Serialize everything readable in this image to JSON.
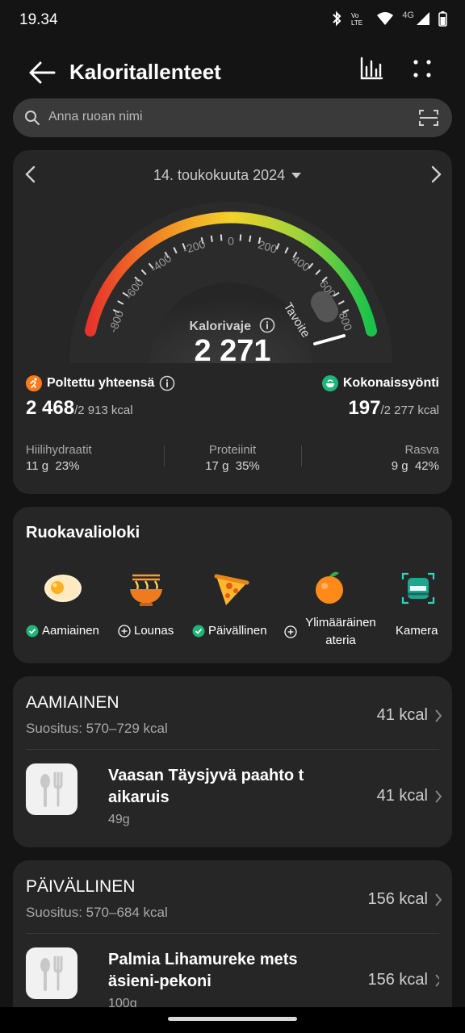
{
  "status": {
    "time": "19.34",
    "network": "4G"
  },
  "header": {
    "title": "Kaloritallenteet"
  },
  "search": {
    "placeholder": "Anna ruoan nimi"
  },
  "summary": {
    "date": "14. toukokuuta 2024",
    "gauge_ticks": [
      "-800",
      "-600",
      "-400",
      "-200",
      "0",
      "200",
      "400",
      "600",
      "800"
    ],
    "goal_label": "Tavoite",
    "deficit_label": "Kalorivaje",
    "deficit_value": "2 271",
    "burned_label": "Poltettu yhteensä",
    "burned_value": "2 468",
    "burned_target": "/2 913 kcal",
    "intake_label": "Kokonaissyönti",
    "intake_value": "197",
    "intake_target": "/2 277 kcal",
    "macros": [
      {
        "label": "Hiilihydraatit",
        "value": "11 g  23%"
      },
      {
        "label": "Proteiinit",
        "value": "17 g  35%"
      },
      {
        "label": "Rasva",
        "value": "9 g  42%"
      }
    ],
    "colors": {
      "burned": "#ff7a1a",
      "intake": "#1fb57a",
      "gauge_low": "#e8332b",
      "gauge_high": "#19c24a"
    }
  },
  "diary": {
    "title": "Ruokavalioloki",
    "items": [
      {
        "label": "Aamiainen",
        "icon": "egg-icon",
        "status": "check"
      },
      {
        "label": "Lounas",
        "icon": "noodle-bowl-icon",
        "status": "add"
      },
      {
        "label": "Päivällinen",
        "icon": "pizza-slice-icon",
        "status": "check"
      },
      {
        "label": "Ylimääräinen ateria",
        "icon": "orange-icon",
        "status": "add"
      },
      {
        "label": "Kamera",
        "icon": "camera-scan-icon",
        "status": "none"
      }
    ]
  },
  "meals": [
    {
      "title": "AAMIAINEN",
      "recommend": "Suositus: 570–729 kcal",
      "kcal": "41 kcal",
      "foods": [
        {
          "name": "Vaasan Täysjyvä paahto t aikaruis",
          "qty": "49g",
          "kcal": "41 kcal"
        }
      ]
    },
    {
      "title": "PÄIVÄLLINEN",
      "recommend": "Suositus: 570–684 kcal",
      "kcal": "156 kcal",
      "foods": [
        {
          "name": "Palmia Lihamureke mets äsieni-pekoni",
          "qty": "100g",
          "kcal": "156 kcal"
        }
      ]
    }
  ]
}
